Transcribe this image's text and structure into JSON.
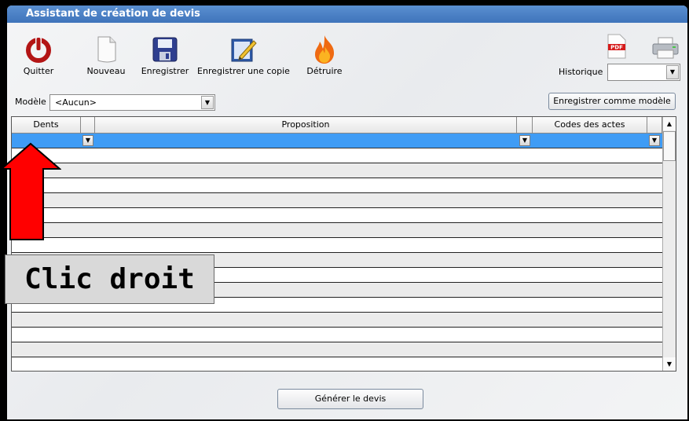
{
  "window": {
    "title": "Assistant de création de devis"
  },
  "toolbar": {
    "quitter": "Quitter",
    "nouveau": "Nouveau",
    "enregistrer": "Enregistrer",
    "enregistrer_copie": "Enregistrer une copie",
    "detruire": "Détruire",
    "historique_label": "Historique",
    "historique_value": "",
    "pdf_icon": "pdf-icon",
    "print_icon": "printer-icon"
  },
  "modele": {
    "label": "Modèle",
    "value": "<Aucun>",
    "save_button": "Enregistrer comme modèle"
  },
  "grid": {
    "columns": [
      "Dents",
      "Proposition",
      "Codes des actes"
    ],
    "empty_row_count": 15
  },
  "actions": {
    "generate": "Générer le devis"
  },
  "annotation": {
    "callout": "Clic droit",
    "arrow_color": "#ff0000"
  },
  "colors": {
    "titlebar": "#4a7fc4",
    "selection": "#3f9cf5"
  }
}
